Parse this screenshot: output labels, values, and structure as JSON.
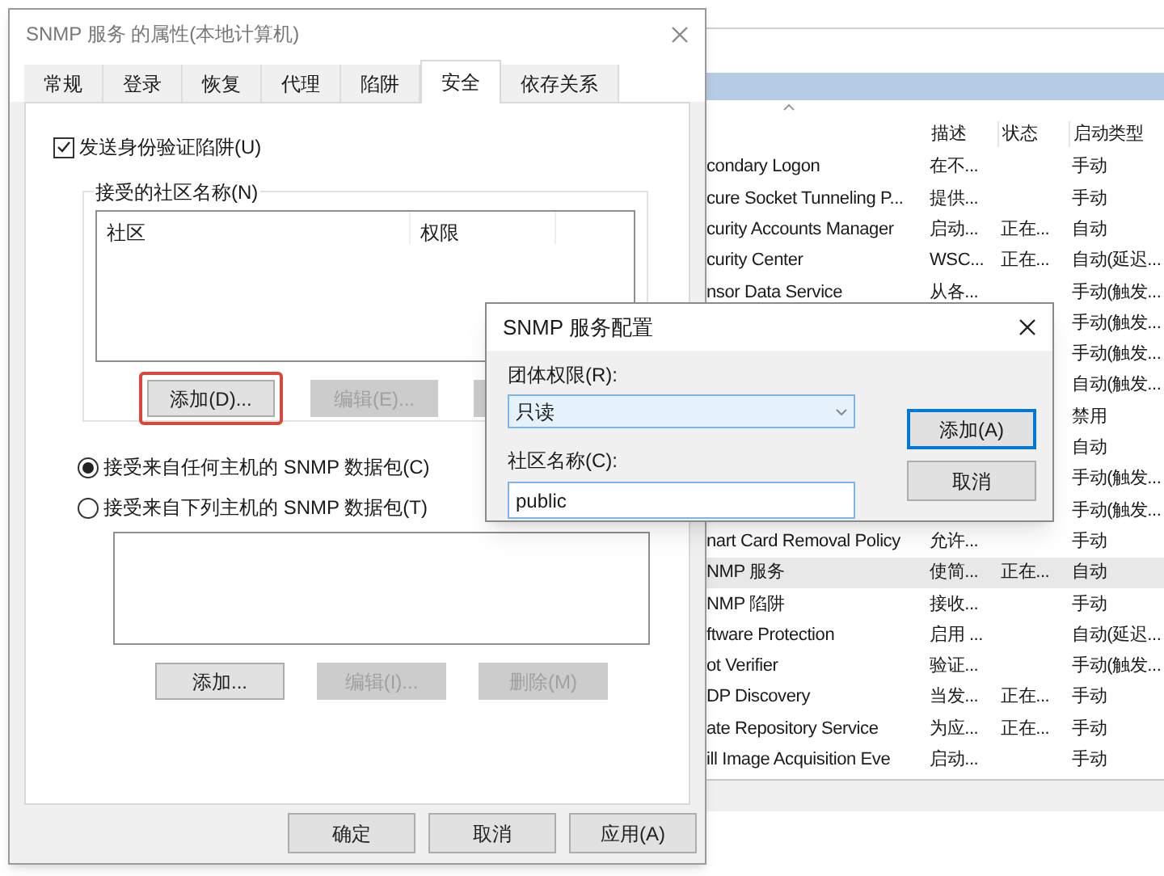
{
  "services_window": {
    "columns": [
      "描述",
      "状态",
      "启动类型"
    ],
    "rows": [
      {
        "name": "condary Logon",
        "description": "在不...",
        "startup_type": "手动",
        "selected": false
      },
      {
        "name": "cure Socket Tunneling P...",
        "description": "提供...",
        "startup_type": "手动",
        "selected": false
      },
      {
        "name": "curity Accounts Manager",
        "description": "启动...",
        "status": "正在...",
        "startup_type": "自动",
        "selected": false
      },
      {
        "name": "curity Center",
        "description": "WSC...",
        "status": "正在...",
        "startup_type": "自动(延迟...",
        "selected": false
      },
      {
        "name": "nsor Data Service",
        "description": "从各...",
        "startup_type": "手动(触发...",
        "selected": false
      },
      {
        "startup_type": "手动(触发...",
        "selected": false
      },
      {
        "startup_type": "手动(触发...",
        "selected": false
      },
      {
        "startup_type": "自动(触发...",
        "selected": false
      },
      {
        "startup_type": "禁用",
        "selected": false
      },
      {
        "startup_type": "自动",
        "selected": false
      },
      {
        "startup_type": "手动(触发...",
        "selected": false
      },
      {
        "startup_type": "手动(触发...",
        "selected": false
      },
      {
        "name": "nart Card Removal Policy",
        "description": "允许...",
        "startup_type": "手动",
        "selected": false
      },
      {
        "name": "NMP 服务",
        "description": "使简...",
        "status": "正在...",
        "startup_type": "自动",
        "selected": true
      },
      {
        "name": "NMP 陷阱",
        "description": "接收...",
        "startup_type": "手动",
        "selected": false
      },
      {
        "name": "ftware Protection",
        "description": "启用 ...",
        "startup_type": "自动(延迟...",
        "selected": false
      },
      {
        "name": "ot Verifier",
        "description": "验证...",
        "startup_type": "手动(触发...",
        "selected": false
      },
      {
        "name": "DP Discovery",
        "description": "当发...",
        "status": "正在...",
        "startup_type": "手动",
        "selected": false
      },
      {
        "name": "ate Repository Service",
        "description": "为应...",
        "status": "正在...",
        "startup_type": "手动",
        "selected": false
      },
      {
        "name": "ill Image Acquisition Eve",
        "description": "启动...",
        "startup_type": "手动",
        "selected": false
      }
    ]
  },
  "properties_dialog": {
    "title": "SNMP 服务 的属性(本地计算机)",
    "tabs": [
      {
        "label": "常规",
        "selected": false
      },
      {
        "label": "登录",
        "selected": false
      },
      {
        "label": "恢复",
        "selected": false
      },
      {
        "label": "代理",
        "selected": false
      },
      {
        "label": "陷阱",
        "selected": false
      },
      {
        "label": "安全",
        "selected": true
      },
      {
        "label": "依存关系",
        "selected": false
      }
    ],
    "send_auth_trap": {
      "label": "发送身份验证陷阱(U)",
      "checked": true
    },
    "community_group": {
      "label": "接受的社区名称(N)",
      "columns": [
        "社区",
        "权限"
      ],
      "buttons": [
        {
          "label": "添加(D)...",
          "disabled": false,
          "highlighted": true
        },
        {
          "label": "编辑(E)...",
          "disabled": true,
          "highlighted": false
        },
        {
          "disabled": true,
          "highlighted": false
        }
      ]
    },
    "host_options": [
      {
        "label": "接受来自任何主机的 SNMP 数据包(C)",
        "selected": true
      },
      {
        "label": "接受来自下列主机的 SNMP 数据包(T)",
        "selected": false
      }
    ],
    "host_buttons": [
      {
        "label": "添加...",
        "disabled": false
      },
      {
        "label": "编辑(I)...",
        "disabled": true
      },
      {
        "label": "删除(M)",
        "disabled": true
      }
    ],
    "footer_buttons": [
      {
        "label": "确定"
      },
      {
        "label": "取消"
      },
      {
        "label": "应用(A)"
      }
    ]
  },
  "config_dialog": {
    "title": "SNMP 服务配置",
    "rights_label": "团体权限(R):",
    "rights_value": "只读",
    "name_label": "社区名称(C):",
    "name_value": "public",
    "buttons": [
      {
        "label": "添加(A)",
        "focused": true
      },
      {
        "label": "取消",
        "focused": false
      }
    ]
  }
}
